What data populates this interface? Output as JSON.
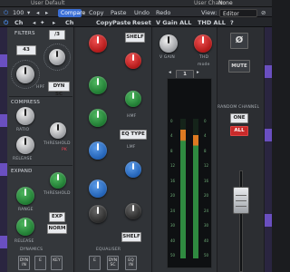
{
  "topbar": {
    "preset_name": "User Default",
    "user_chain_label": "User Chain:",
    "user_chain_value": "None"
  },
  "toolbar": {
    "zoom": "100",
    "compare_label": "Compare",
    "menu": [
      "Copy",
      "Paste",
      "Undo",
      "Redo"
    ],
    "view_label": "View:",
    "view_value": "Editor"
  },
  "plugin_bar": {
    "items": [
      "Ch",
      "Copy",
      "Paste",
      "Reset"
    ],
    "vgain": "V Gain ALL",
    "thd": "THD ALL"
  },
  "filters": {
    "title": "FILTERS",
    "hpf_btn": "43",
    "lpf_btn": "/3",
    "dyn_sc": "DYN SC",
    "hpf_label": "HPF"
  },
  "compress": {
    "title": "COMPRESS",
    "ratio": "RATIO",
    "threshold": "THRESHOLD",
    "release": "RELEASE",
    "pk": "PK"
  },
  "expand": {
    "title": "EXPAND",
    "range": "RANGE",
    "threshold": "THRESHOLD",
    "release": "RELEASE",
    "exp": "EXP",
    "norm": "NORM"
  },
  "dynamics": {
    "title": "DYNAMICS",
    "btns": [
      "DYN IN",
      "E",
      "KEY"
    ]
  },
  "eq": {
    "shelf_top": "SHELF",
    "hmf": "HMF",
    "eq_type": "EQ TYPE",
    "lmf": "LMF",
    "shelf_bot": "SHELF",
    "title": "EQUALISER",
    "btns": [
      "E",
      "DYN SC",
      "EQ IN"
    ]
  },
  "channel": {
    "vgain": "V GAIN",
    "thd": "THD",
    "mode": "mode",
    "num": "1",
    "meter_ticks": [
      "0",
      "4",
      "8",
      "12",
      "16",
      "20",
      "24",
      "30",
      "40",
      "50"
    ],
    "meter_level_left": 0.08,
    "meter_level_right": 0.12
  },
  "right": {
    "phase": "Ø",
    "mute": "MUTE",
    "random": "RANDOM CHANNEL",
    "one": "ONE",
    "all": "ALL",
    "fader_level": 0.78
  },
  "colors": {
    "accent": "#3b6fd6",
    "red": "#c82a2a",
    "green": "#1f7a32",
    "blue": "#2161b5"
  }
}
